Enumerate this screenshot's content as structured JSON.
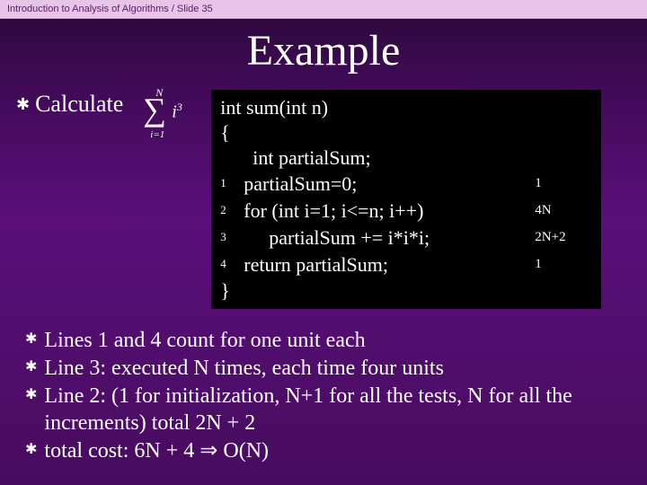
{
  "header": "Introduction to Analysis of Algorithms / Slide 35",
  "title": "Example",
  "calc": {
    "label": "Calculate",
    "sigma_top": "N",
    "sigma_bottom": "i=1",
    "sigma_expr_base": "i",
    "sigma_expr_sup": "3"
  },
  "code": {
    "sig": "int sum(int n)",
    "open": "{",
    "decl": "int partialSum;",
    "lines": [
      {
        "num": "1",
        "text": "partialSum=0;",
        "cost": "1"
      },
      {
        "num": "2",
        "text": "for (int i=1; i<=n; i++)",
        "cost": "4N"
      },
      {
        "num": "3",
        "text": "partialSum += i*i*i;",
        "cost": "2N+2",
        "indent": true
      },
      {
        "num": "4",
        "text": "return partialSum;",
        "cost": "1"
      }
    ],
    "close": "}"
  },
  "bullets": [
    "Lines 1 and 4 count for one unit each",
    "Line 3: executed N times, each time four units",
    "Line 2: (1 for initialization, N+1 for all the tests, N for all the increments) total 2N + 2",
    "total cost: 6N + 4 ⇒ O(N)"
  ]
}
